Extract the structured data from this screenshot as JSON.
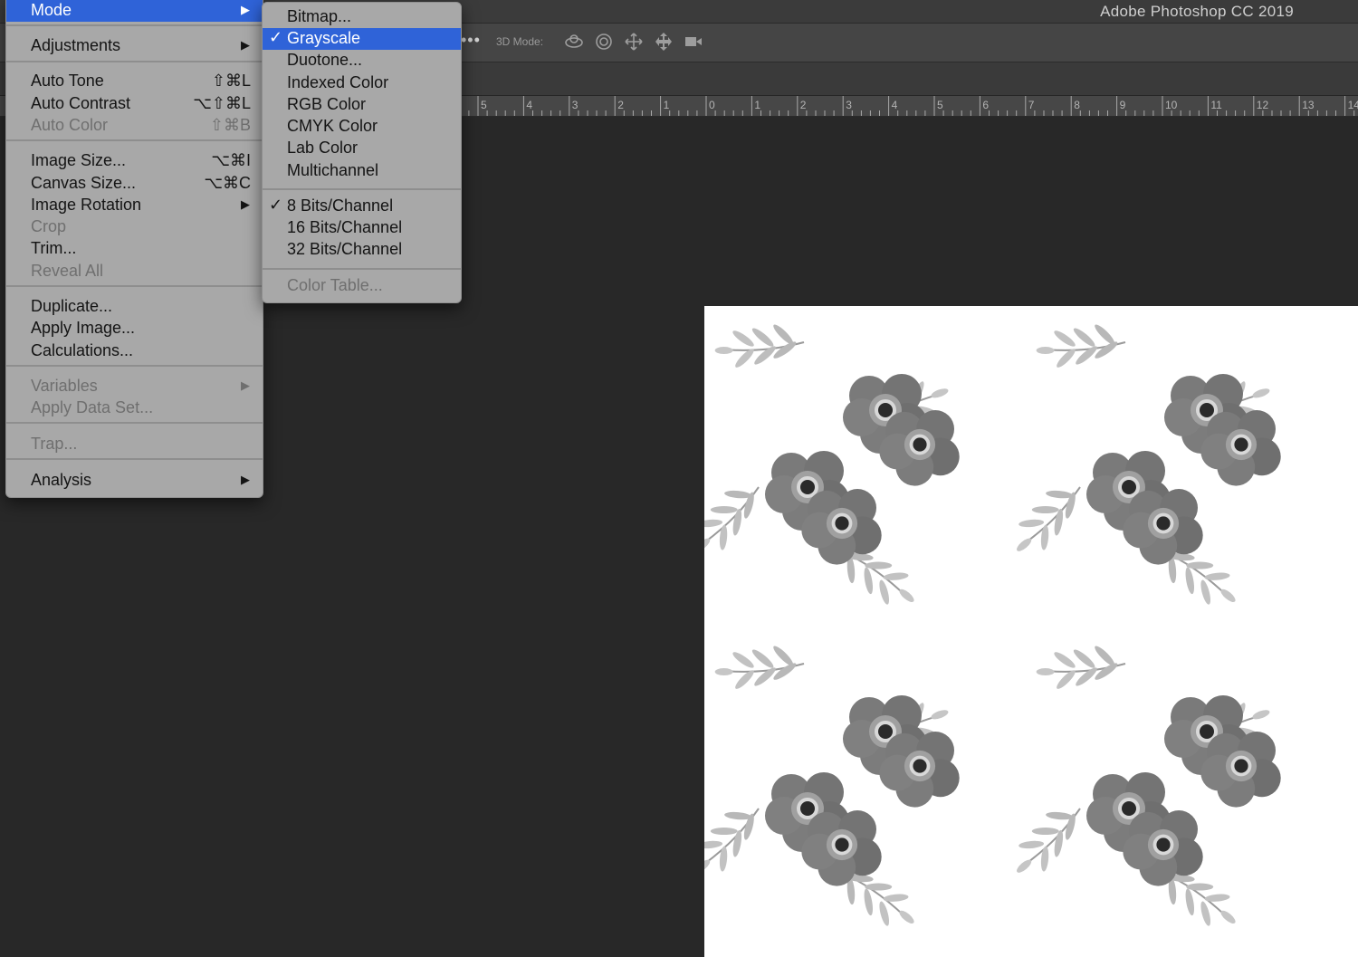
{
  "app": {
    "title": "Adobe Photoshop CC 2019"
  },
  "options_bar": {
    "more": "•••",
    "three_d_mode_label": "3D Mode:",
    "icons": [
      "3d-orbit-icon",
      "3d-roll-icon",
      "3d-pan-icon",
      "3d-slide-icon",
      "3d-scale-camera-icon"
    ]
  },
  "ruler": {
    "labels": [
      "5",
      "4",
      "3",
      "2",
      "1",
      "0",
      "1",
      "2",
      "3",
      "4",
      "5",
      "6",
      "7",
      "8",
      "9",
      "10",
      "11",
      "12",
      "13",
      "14"
    ]
  },
  "image_menu": {
    "items": [
      {
        "label": "Mode",
        "shortcut": "",
        "submenu": true,
        "disabled": false,
        "highlighted": true
      },
      {
        "label": "Adjustments",
        "shortcut": "",
        "submenu": true,
        "disabled": false
      },
      {
        "label": "Auto Tone",
        "shortcut": "⇧⌘L",
        "submenu": false,
        "disabled": false
      },
      {
        "label": "Auto Contrast",
        "shortcut": "⌥⇧⌘L",
        "submenu": false,
        "disabled": false
      },
      {
        "label": "Auto Color",
        "shortcut": "⇧⌘B",
        "submenu": false,
        "disabled": true
      },
      {
        "label": "Image Size...",
        "shortcut": "⌥⌘I",
        "submenu": false,
        "disabled": false
      },
      {
        "label": "Canvas Size...",
        "shortcut": "⌥⌘C",
        "submenu": false,
        "disabled": false
      },
      {
        "label": "Image Rotation",
        "shortcut": "",
        "submenu": true,
        "disabled": false
      },
      {
        "label": "Crop",
        "shortcut": "",
        "submenu": false,
        "disabled": true
      },
      {
        "label": "Trim...",
        "shortcut": "",
        "submenu": false,
        "disabled": false
      },
      {
        "label": "Reveal All",
        "shortcut": "",
        "submenu": false,
        "disabled": true
      },
      {
        "label": "Duplicate...",
        "shortcut": "",
        "submenu": false,
        "disabled": false
      },
      {
        "label": "Apply Image...",
        "shortcut": "",
        "submenu": false,
        "disabled": false
      },
      {
        "label": "Calculations...",
        "shortcut": "",
        "submenu": false,
        "disabled": false
      },
      {
        "label": "Variables",
        "shortcut": "",
        "submenu": true,
        "disabled": true
      },
      {
        "label": "Apply Data Set...",
        "shortcut": "",
        "submenu": false,
        "disabled": true
      },
      {
        "label": "Trap...",
        "shortcut": "",
        "submenu": false,
        "disabled": true
      },
      {
        "label": "Analysis",
        "shortcut": "",
        "submenu": true,
        "disabled": false
      }
    ],
    "submenu_arrow": "▶"
  },
  "mode_submenu": {
    "check_glyph": "✓",
    "items": [
      {
        "label": "Bitmap...",
        "checked": false,
        "disabled": false
      },
      {
        "label": "Grayscale",
        "checked": true,
        "disabled": false,
        "highlighted": true
      },
      {
        "label": "Duotone...",
        "checked": false,
        "disabled": false
      },
      {
        "label": "Indexed Color",
        "checked": false,
        "disabled": false
      },
      {
        "label": "RGB Color",
        "checked": false,
        "disabled": false
      },
      {
        "label": "CMYK Color",
        "checked": false,
        "disabled": false
      },
      {
        "label": "Lab Color",
        "checked": false,
        "disabled": false
      },
      {
        "label": "Multichannel",
        "checked": false,
        "disabled": false
      },
      {
        "label": "8 Bits/Channel",
        "checked": true,
        "disabled": false
      },
      {
        "label": "16 Bits/Channel",
        "checked": false,
        "disabled": false
      },
      {
        "label": "32 Bits/Channel",
        "checked": false,
        "disabled": false
      },
      {
        "label": "Color Table...",
        "checked": false,
        "disabled": true
      }
    ]
  },
  "colors": {
    "menu_bg": "#a8a8a8",
    "highlight": "#2f63d8",
    "workspace": "#282828"
  },
  "document": {
    "content": "grayscale floral pattern"
  }
}
